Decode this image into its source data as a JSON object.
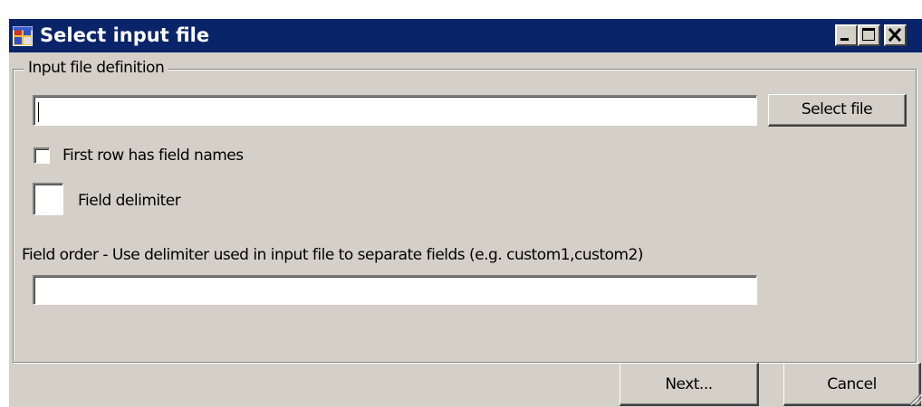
{
  "window": {
    "title": "Select input file"
  },
  "group": {
    "legend": "Input file definition"
  },
  "file_path": {
    "value": ""
  },
  "select_file_button": {
    "label": "Select file"
  },
  "first_row_checkbox": {
    "label": "First row has field names",
    "checked": false
  },
  "field_delimiter": {
    "value": "",
    "label": "Field delimiter"
  },
  "field_order": {
    "label": "Field order - Use delimiter used in input file to separate fields (e.g. custom1,custom2)",
    "value": ""
  },
  "footer": {
    "next_label": "Next...",
    "cancel_label": "Cancel"
  },
  "colors": {
    "titlebar": "#0a246a",
    "face": "#d4d0c8"
  },
  "icons": {
    "app": "app-window-icon",
    "minimize": "minimize-icon",
    "maximize": "maximize-icon",
    "close": "close-icon",
    "grip": "resize-grip-icon"
  }
}
